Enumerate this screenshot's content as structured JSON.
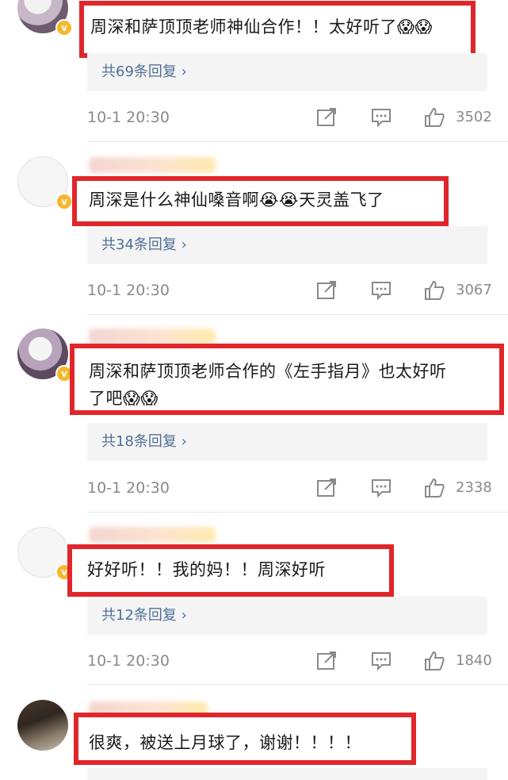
{
  "comments": [
    {
      "text": "周深和萨顶顶老师神仙合作！！太好听了😱😱",
      "replies": "共69条回复 ›",
      "time": "10-1 20:30",
      "likes": "3502"
    },
    {
      "text": "周深是什么神仙嗓音啊😭😭天灵盖飞了",
      "replies": "共34条回复 ›",
      "time": "10-1 20:30",
      "likes": "3067"
    },
    {
      "text_line1": "周深和萨顶顶老师合作的《左手指月》也太好听",
      "text_line2": "了吧😱😱",
      "replies": "共18条回复 ›",
      "time": "10-1 20:30",
      "likes": "2338"
    },
    {
      "text": "好好听！！我的妈！！周深好听",
      "replies": "共12条回复 ›",
      "time": "10-1 20:30",
      "likes": "1840"
    },
    {
      "text": "很爽，被送上月球了，谢谢！！！！"
    }
  ],
  "icons": [
    "share-icon",
    "comment-icon",
    "like-icon",
    "verified-badge-icon"
  ],
  "colors": {
    "highlight_border": "#e0262b",
    "reply_link": "#4f6f96",
    "badge": "#f6b72b"
  }
}
